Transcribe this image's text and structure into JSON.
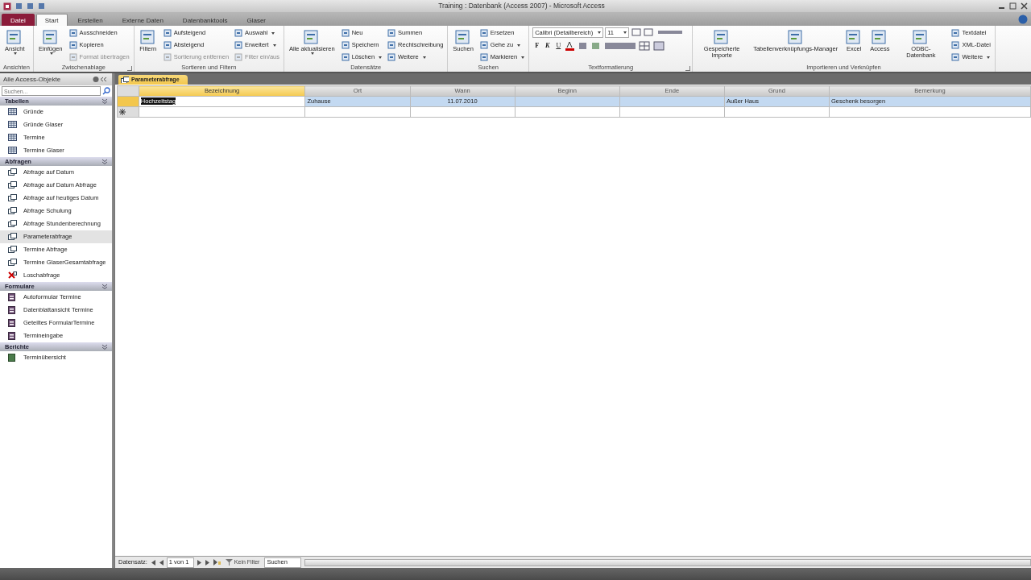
{
  "window": {
    "title": "Training : Datenbank (Access 2007) - Microsoft Access"
  },
  "tabs": [
    {
      "label": "Datei",
      "kind": "file",
      "selected": false
    },
    {
      "label": "Start",
      "kind": "tab",
      "selected": true
    },
    {
      "label": "Erstellen",
      "kind": "tab",
      "selected": false
    },
    {
      "label": "Externe Daten",
      "kind": "tab",
      "selected": false
    },
    {
      "label": "Datenbanktools",
      "kind": "tab",
      "selected": false
    },
    {
      "label": "Glaser",
      "kind": "tab",
      "selected": false
    }
  ],
  "ribbon": {
    "groups": [
      {
        "label": "Ansichten",
        "launcher": false,
        "columns": [
          [
            {
              "label": "Ansicht",
              "kind": "large",
              "dropdown": true
            }
          ]
        ]
      },
      {
        "label": "Zwischenablage",
        "launcher": true,
        "columns": [
          [
            {
              "label": "Einfügen",
              "kind": "large",
              "dropdown": true
            }
          ],
          [
            {
              "label": "Ausschneiden",
              "kind": "small",
              "dropdown": false,
              "disabled": false
            },
            {
              "label": "Kopieren",
              "kind": "small",
              "dropdown": false,
              "disabled": false
            },
            {
              "label": "Format übertragen",
              "kind": "small",
              "dropdown": false,
              "disabled": true
            }
          ]
        ]
      },
      {
        "label": "Sortieren und Filtern",
        "launcher": false,
        "columns": [
          [
            {
              "label": "Filtern",
              "kind": "large",
              "dropdown": false
            }
          ],
          [
            {
              "label": "Aufsteigend",
              "kind": "small",
              "dropdown": false,
              "disabled": false
            },
            {
              "label": "Absteigend",
              "kind": "small",
              "dropdown": false,
              "disabled": false
            },
            {
              "label": "Sortierung entfernen",
              "kind": "small",
              "dropdown": false,
              "disabled": true
            }
          ],
          [
            {
              "label": "Auswahl",
              "kind": "small",
              "dropdown": true,
              "disabled": false
            },
            {
              "label": "Erweitert",
              "kind": "small",
              "dropdown": true,
              "disabled": false
            },
            {
              "label": "Filter ein/aus",
              "kind": "small",
              "dropdown": false,
              "disabled": true
            }
          ]
        ]
      },
      {
        "label": "Datensätze",
        "launcher": false,
        "columns": [
          [
            {
              "label": "Alle aktualisieren",
              "kind": "large",
              "dropdown": true
            }
          ],
          [
            {
              "label": "Neu",
              "kind": "small",
              "dropdown": false,
              "disabled": false
            },
            {
              "label": "Speichern",
              "kind": "small",
              "dropdown": false,
              "disabled": false
            },
            {
              "label": "Löschen",
              "kind": "small",
              "dropdown": true,
              "disabled": false
            }
          ],
          [
            {
              "label": "Summen",
              "kind": "small",
              "dropdown": false,
              "disabled": false
            },
            {
              "label": "Rechtschreibung",
              "kind": "small",
              "dropdown": false,
              "disabled": false
            },
            {
              "label": "Weitere",
              "kind": "small",
              "dropdown": true,
              "disabled": false
            }
          ]
        ]
      },
      {
        "label": "Suchen",
        "launcher": false,
        "columns": [
          [
            {
              "label": "Suchen",
              "kind": "large",
              "dropdown": false
            }
          ],
          [
            {
              "label": "Ersetzen",
              "kind": "small",
              "dropdown": false,
              "disabled": false
            },
            {
              "label": "Gehe zu",
              "kind": "small",
              "dropdown": true,
              "disabled": false
            },
            {
              "label": "Markieren",
              "kind": "small",
              "dropdown": true,
              "disabled": false
            }
          ]
        ]
      },
      {
        "label": "Textformatierung",
        "launcher": true,
        "kind": "font",
        "font_name": "Calibri (Detailbereich)",
        "font_size": "11",
        "format_buttons": [
          "F",
          "K",
          "U"
        ]
      },
      {
        "label": "Importieren und Verknüpfen",
        "launcher": false,
        "columns": [
          [
            {
              "label": "Gespeicherte Importe",
              "kind": "large",
              "dropdown": false
            }
          ],
          [
            {
              "label": "Tabellenverknüpfungs-Manager",
              "kind": "large",
              "dropdown": false
            }
          ],
          [
            {
              "label": "Excel",
              "kind": "large",
              "dropdown": false
            }
          ],
          [
            {
              "label": "Access",
              "kind": "large",
              "dropdown": false
            }
          ],
          [
            {
              "label": "ODBC-Datenbank",
              "kind": "large",
              "dropdown": false
            }
          ],
          [
            {
              "label": "Textdatei",
              "kind": "small",
              "dropdown": false,
              "disabled": false
            },
            {
              "label": "XML-Datei",
              "kind": "small",
              "dropdown": false,
              "disabled": false
            },
            {
              "label": "Weitere",
              "kind": "small",
              "dropdown": true,
              "disabled": false
            }
          ]
        ]
      }
    ]
  },
  "nav": {
    "title": "Alle Access-Objekte",
    "search": {
      "placeholder": "Suchen..."
    },
    "sections": [
      {
        "label": "Tabellen",
        "kind": "table",
        "items": [
          {
            "label": "Gründe",
            "selected": false
          },
          {
            "label": "Gründe Glaser",
            "selected": false
          },
          {
            "label": "Termine",
            "selected": false
          },
          {
            "label": "Termine Glaser",
            "selected": false
          }
        ]
      },
      {
        "label": "Abfragen",
        "kind": "query",
        "items": [
          {
            "label": "Abfrage auf Datum",
            "selected": false
          },
          {
            "label": "Abfrage auf Datum Abfrage",
            "selected": false
          },
          {
            "label": "Abfrage auf heutiges Datum",
            "selected": false
          },
          {
            "label": "Abfrage Schulung",
            "selected": false
          },
          {
            "label": "Abfrage Stundenberechnung",
            "selected": false
          },
          {
            "label": "Parameterabfrage",
            "selected": true
          },
          {
            "label": "Termine Abfrage",
            "selected": false
          },
          {
            "label": "Termine GlaserGesamtabfrage",
            "selected": false
          },
          {
            "label": "Loschabfrage",
            "selected": false,
            "kind": "delete"
          }
        ]
      },
      {
        "label": "Formulare",
        "kind": "form",
        "items": [
          {
            "label": "Autoformular Termine",
            "selected": false
          },
          {
            "label": "Datenblattansicht Termine",
            "selected": false
          },
          {
            "label": "Geteiltes FormularTermine",
            "selected": false
          },
          {
            "label": "Termineingabe",
            "selected": false
          }
        ]
      },
      {
        "label": "Berichte",
        "kind": "report",
        "items": [
          {
            "label": "Terminübersicht",
            "selected": false
          }
        ]
      }
    ]
  },
  "document_tab": {
    "label": "Parameterabfrage"
  },
  "table": {
    "columns": [
      {
        "label": "Bezeichnung",
        "selected": true
      },
      {
        "label": "Ort",
        "selected": false
      },
      {
        "label": "Wann",
        "selected": false
      },
      {
        "label": "Beginn",
        "selected": false
      },
      {
        "label": "Ende",
        "selected": false
      },
      {
        "label": "Grund",
        "selected": false
      },
      {
        "label": "Bemerkung",
        "selected": false
      }
    ],
    "rows": [
      {
        "selected": true,
        "cells": [
          "Hochzeitstag",
          "Zuhause",
          "11.07.2010",
          "",
          "",
          "Außer Haus",
          "Geschenk besorgen"
        ]
      }
    ]
  },
  "record_nav": {
    "label": "Datensatz:",
    "position": "1 von 1",
    "filter": "Kein Filter",
    "search": "Suchen"
  }
}
